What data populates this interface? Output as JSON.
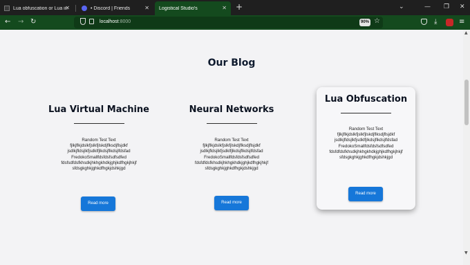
{
  "browser": {
    "tabs": [
      {
        "title": "Lua obfuscation or Lua in gen",
        "favicon": "tab-icon-dark",
        "active": false
      },
      {
        "title": "• Discord | Friends",
        "favicon": "discord-icon",
        "active": false
      },
      {
        "title": "Logistical Studio's",
        "favicon": "",
        "active": true
      }
    ],
    "address": {
      "host": "localhost",
      "port": ":8000"
    },
    "zoom": "90%"
  },
  "page": {
    "section_title": "Our Blog",
    "read_more_label": "Read more",
    "cards": [
      {
        "title": "Lua Virtual Machine",
        "text_lines": [
          "Random Test Text",
          "fjlkjflkjdslkfjslkfjlskdjflksdjflsjdkf",
          "jsdlkjfldsjlkfjsdklfjlkdsjflkdsjlfdsfad",
          "FredokoSmallfdsfdsfsdfsdfed",
          "fdsfsdfdsfkhsdkjhkhgkhdkjghjkdfhgkjhkjf",
          "sfdsgkghkjghkdfhgkjdshkjgd"
        ],
        "highlighted": false
      },
      {
        "title": "Neural Networks",
        "text_lines": [
          "Random Test Text",
          "fjlkjflkjdslkfjslkfjlskdjflksdjflsjdkf",
          "jsdlkjfldsjlkfjsdklfjlkdsjflkdsjlfdsfad",
          "FredokoSmallfdsfdsfsdfsdfed",
          "fdsfdfdsfkhsdkjhkhgkhdkjghjkdfhgkjhkjf",
          "sfdsgkghkjghkdfhgkjdshkjgd"
        ],
        "highlighted": false
      },
      {
        "title": "Lua Obfuscation",
        "text_lines": [
          "Random Test Text",
          "fjlkjflkjdslkfjslkfjlskdjflksdjflsjdkf",
          "jsdlkjfldsjlkfjsdklfjlkdsjflkdsjlfdsfad",
          "FredokoSmallfdsfdsfsdfsdfed",
          "fdsfdfdsfkhsdkjhkhgkhdkjghjkdfhgkjhkjf",
          "sfdsgkghkjghkdfhgkjdshkjgd"
        ],
        "highlighted": true
      }
    ]
  },
  "colors": {
    "toolbar_green": "#144a1e",
    "button_blue": "#1677d9",
    "heading_navy": "#0e1a2e",
    "page_bg": "#f3f3f5"
  }
}
